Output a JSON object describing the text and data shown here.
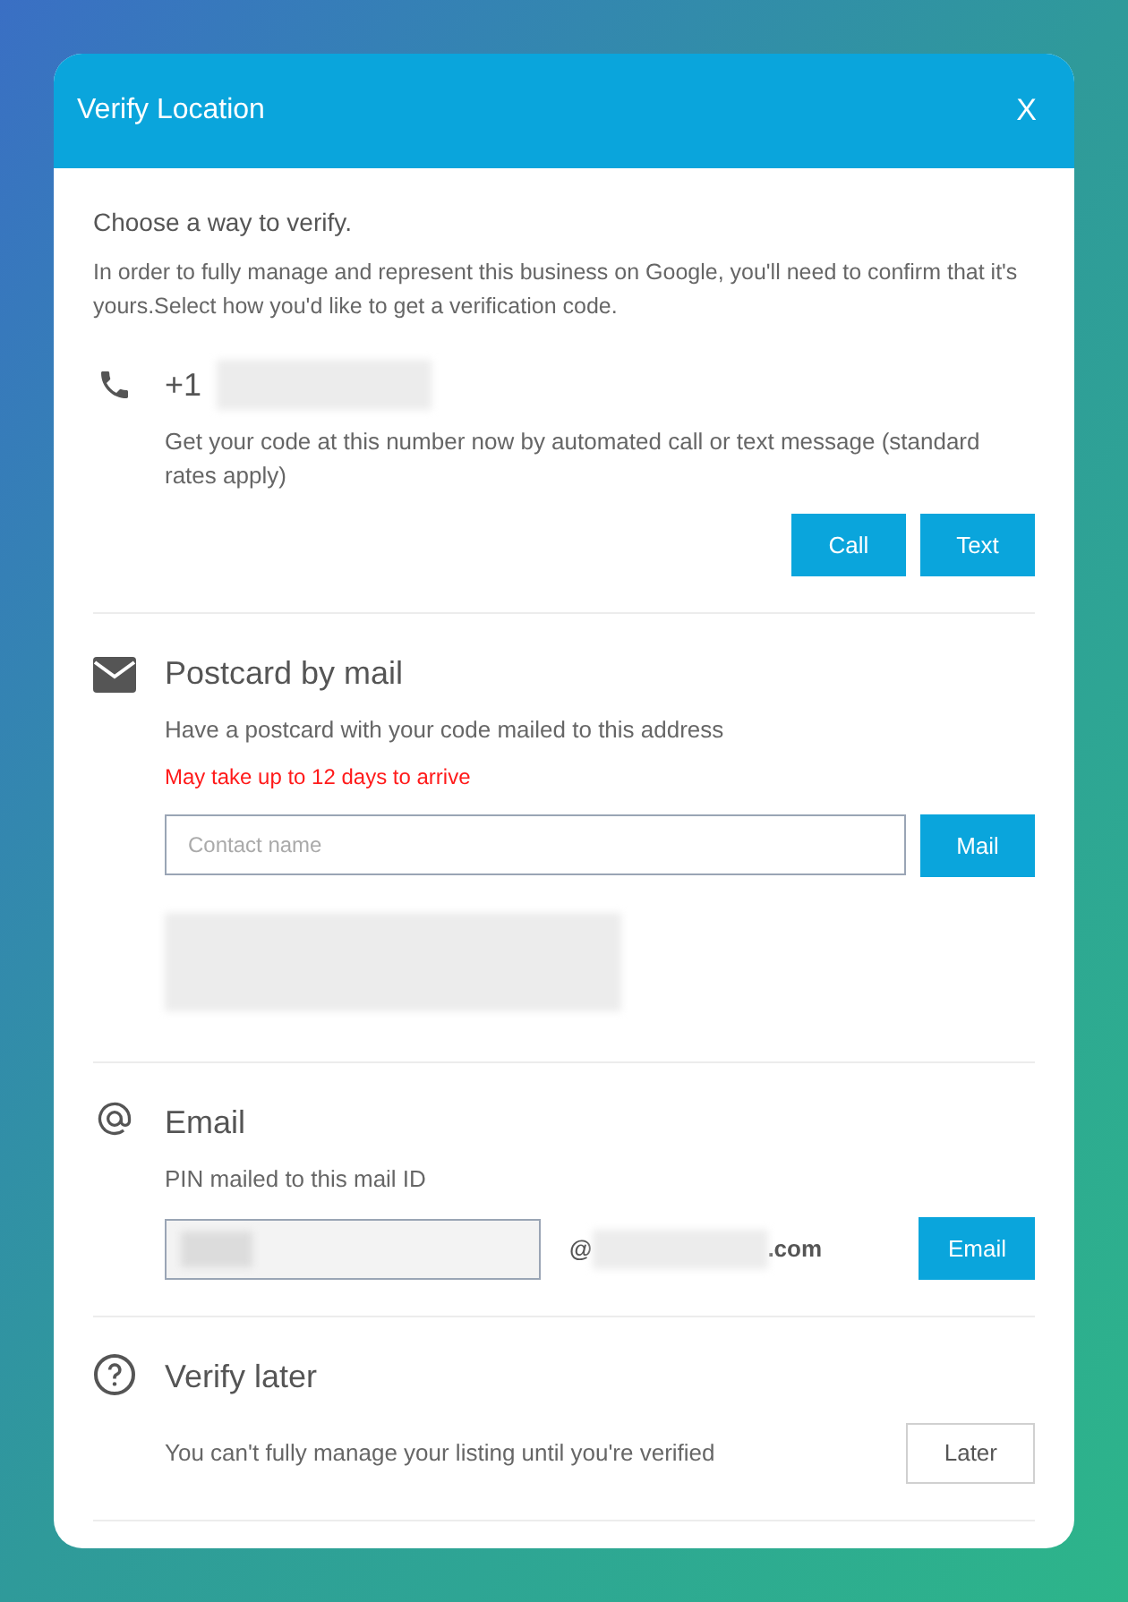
{
  "dialog": {
    "title": "Verify Location",
    "close": "X"
  },
  "intro": {
    "heading": "Choose a way to verify.",
    "text": "In order to fully manage and represent this business on Google, you'll need to confirm that it's yours.Select how you'd like to get a verification code."
  },
  "sections": [
    {
      "kind": "phone",
      "title": "+1",
      "description": "Get your code at this number now by automated call or text message (standard rates apply)",
      "buttons": [
        "Call",
        "Text"
      ]
    },
    {
      "kind": "postcard",
      "title": "Postcard by mail",
      "description": "Have a postcard with your code mailed to this address",
      "warning": "May take up to 12 days to arrive",
      "field": {
        "placeholder": "Contact name"
      },
      "buttons": [
        "Mail"
      ]
    },
    {
      "kind": "email",
      "title": "Email",
      "description": "PIN mailed to this mail ID",
      "at": "@",
      "domain_suffix": ".com",
      "buttons": [
        "Email"
      ]
    },
    {
      "kind": "later",
      "title": "Verify later",
      "description": "You can't fully manage your listing until you're verified",
      "buttons": [
        "Later"
      ]
    }
  ]
}
